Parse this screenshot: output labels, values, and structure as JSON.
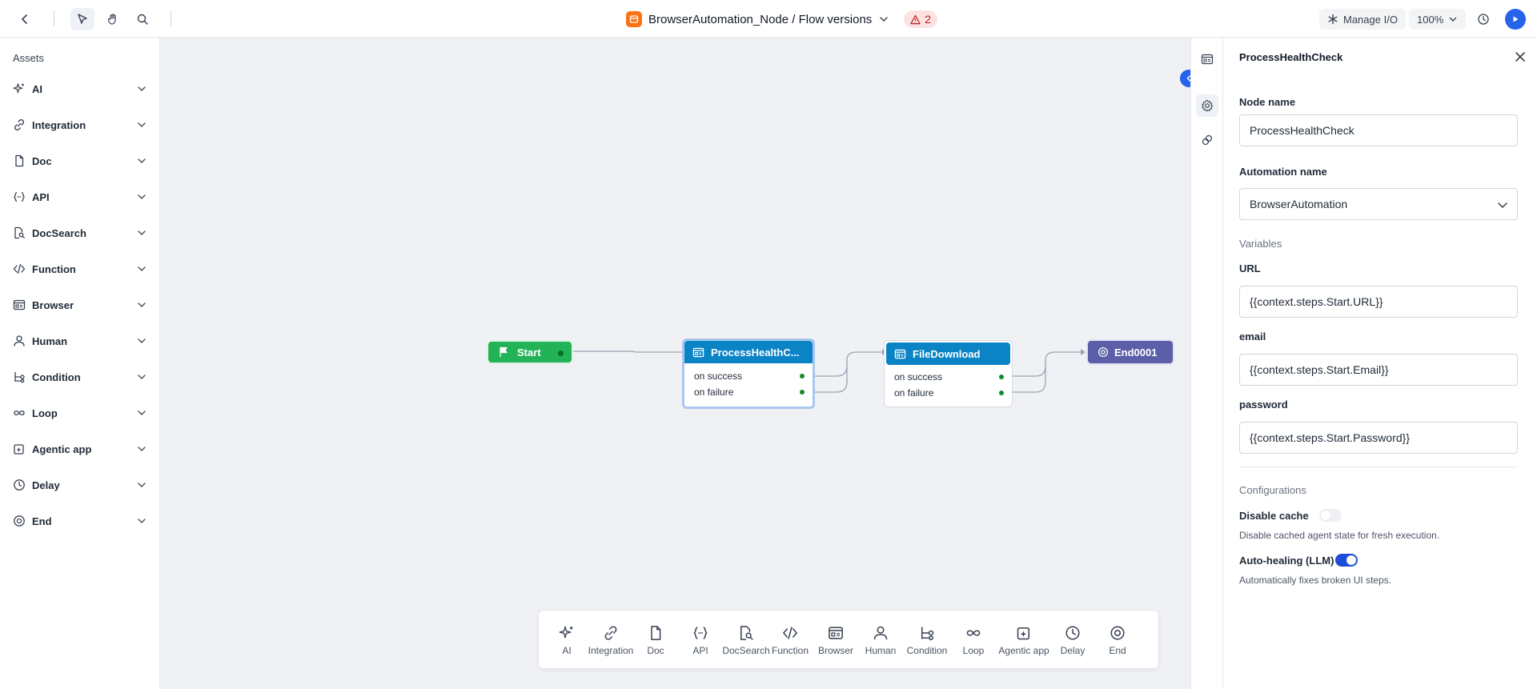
{
  "header": {
    "title": "BrowserAutomation_Node / Flow versions",
    "warning_count": "2",
    "manage_io_label": "Manage I/O",
    "zoom_label": "100%"
  },
  "sidebar": {
    "title": "Assets",
    "items": [
      {
        "label": "AI",
        "icon": "sparkle-icon"
      },
      {
        "label": "Integration",
        "icon": "link-icon"
      },
      {
        "label": "Doc",
        "icon": "document-icon"
      },
      {
        "label": "API",
        "icon": "braces-icon"
      },
      {
        "label": "DocSearch",
        "icon": "doc-search-icon"
      },
      {
        "label": "Function",
        "icon": "code-icon"
      },
      {
        "label": "Browser",
        "icon": "browser-icon"
      },
      {
        "label": "Human",
        "icon": "person-icon"
      },
      {
        "label": "Condition",
        "icon": "branch-icon"
      },
      {
        "label": "Loop",
        "icon": "infinity-icon"
      },
      {
        "label": "Agentic app",
        "icon": "agentic-app-icon"
      },
      {
        "label": "Delay",
        "icon": "clock-icon"
      },
      {
        "label": "End",
        "icon": "end-circle-icon"
      }
    ]
  },
  "canvas": {
    "nodes": {
      "start": {
        "label": "Start"
      },
      "process": {
        "label": "ProcessHealthC...",
        "success": "on success",
        "failure": "on failure"
      },
      "download": {
        "label": "FileDownload",
        "success": "on success",
        "failure": "on failure"
      },
      "end": {
        "label": "End0001"
      }
    },
    "colors": {
      "start": "#22b357",
      "process": "#0b84c6",
      "end": "#5b5ea8",
      "accent": "#2563eb"
    }
  },
  "toolbar": {
    "items": [
      {
        "label": "AI",
        "icon": "sparkle-icon"
      },
      {
        "label": "Integration",
        "icon": "link-icon"
      },
      {
        "label": "Doc",
        "icon": "document-icon"
      },
      {
        "label": "API",
        "icon": "braces-icon"
      },
      {
        "label": "DocSearch",
        "icon": "doc-search-icon"
      },
      {
        "label": "Function",
        "icon": "code-icon"
      },
      {
        "label": "Browser",
        "icon": "browser-icon"
      },
      {
        "label": "Human",
        "icon": "person-icon"
      },
      {
        "label": "Condition",
        "icon": "branch-icon"
      },
      {
        "label": "Loop",
        "icon": "infinity-icon"
      },
      {
        "label": "Agentic app",
        "icon": "agentic-app-icon"
      },
      {
        "label": "Delay",
        "icon": "clock-icon"
      },
      {
        "label": "End",
        "icon": "end-circle-icon"
      }
    ]
  },
  "panel": {
    "title": "ProcessHealthCheck",
    "node_name_label": "Node name",
    "node_name_value": "ProcessHealthCheck",
    "automation_label": "Automation name",
    "automation_value": "BrowserAutomation",
    "variables_label": "Variables",
    "url_label": "URL",
    "url_value": "{{context.steps.Start.URL}}",
    "email_label": "email",
    "email_value": "{{context.steps.Start.Email}}",
    "password_label": "password",
    "password_value": "{{context.steps.Start.Password}}",
    "config_label": "Configurations",
    "disable_cache_label": "Disable cache",
    "disable_cache_on": false,
    "disable_cache_help": "Disable cached agent state for fresh execution.",
    "auto_heal_label": "Auto-healing (LLM)",
    "auto_heal_on": true,
    "auto_heal_help": "Automatically fixes broken UI steps."
  }
}
